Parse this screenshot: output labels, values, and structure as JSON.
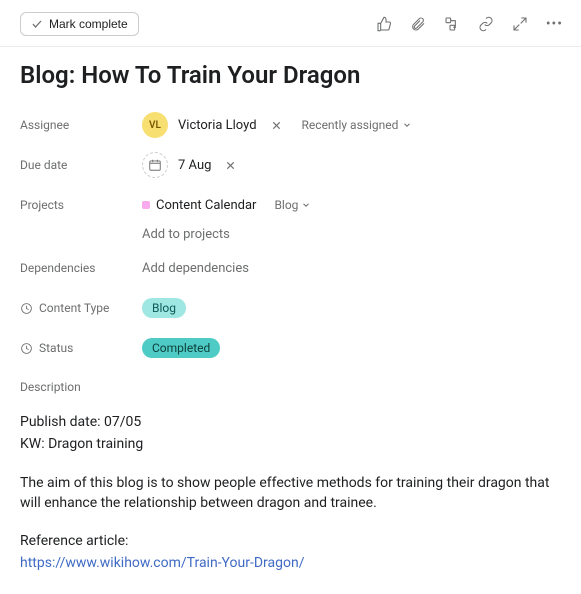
{
  "toolbar": {
    "mark_complete_label": "Mark complete"
  },
  "title": "Blog: How To Train Your Dragon",
  "fields": {
    "assignee": {
      "label": "Assignee",
      "initials": "VL",
      "name": "Victoria Lloyd",
      "recent_label": "Recently assigned"
    },
    "due_date": {
      "label": "Due date",
      "value": "7 Aug"
    },
    "projects": {
      "label": "Projects",
      "name": "Content Calendar",
      "column": "Blog",
      "add_label": "Add to projects"
    },
    "dependencies": {
      "label": "Dependencies",
      "add_label": "Add dependencies"
    },
    "content_type": {
      "label": "Content Type",
      "value": "Blog"
    },
    "status": {
      "label": "Status",
      "value": "Completed"
    }
  },
  "description": {
    "label": "Description",
    "line1": "Publish date: 07/05",
    "line2": "KW: Dragon training",
    "paragraph": "The aim of this blog is to show people effective methods for training their dragon that will enhance the relationship between dragon and trainee.",
    "ref_label": "Reference article:",
    "ref_link": "https://www.wikihow.com/Train-Your-Dragon/"
  }
}
